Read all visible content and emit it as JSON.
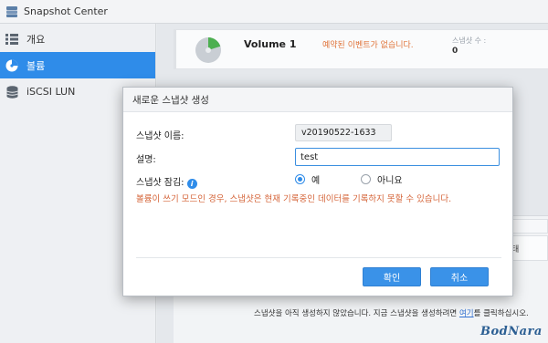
{
  "app": {
    "title": "Snapshot Center"
  },
  "sidebar": {
    "items": [
      {
        "label": "개요",
        "icon": "overview-icon"
      },
      {
        "label": "볼륨",
        "icon": "volume-icon",
        "active": true
      },
      {
        "label": "iSCSI LUN",
        "icon": "iscsi-lun-icon"
      }
    ]
  },
  "main": {
    "volume": {
      "name": "Volume 1",
      "status": "예약된 이벤트가 없습니다.",
      "count_label": "스냅샷 수 :",
      "count": "0"
    },
    "column_header": "태",
    "note_prefix": "스냅샷을 아직 생성하지 않았습니다. 지금 스냅샷을 생성하려면 ",
    "note_link": "여기",
    "note_suffix": "를 클릭하십시오."
  },
  "dialog": {
    "title": "새로운 스냅샷 생성",
    "name_label": "스냅샷 이름:",
    "name_value": "v20190522-1633",
    "desc_label": "설명:",
    "desc_value": "test",
    "lock_label": "스냅샷 잠김:",
    "lock_options": [
      {
        "label": "예",
        "selected": true
      },
      {
        "label": "아니요",
        "selected": false
      }
    ],
    "warning": "볼륨이 쓰기 모드인 경우, 스냅샷은 현재 기록중인 데이터를 기록하지 못할 수 있습니다.",
    "confirm_label": "확인",
    "cancel_label": "취소"
  },
  "watermark": "BodNara",
  "colors": {
    "accent": "#2f8ce9",
    "warning": "#d5653a",
    "volume_used": "#4caf50"
  }
}
